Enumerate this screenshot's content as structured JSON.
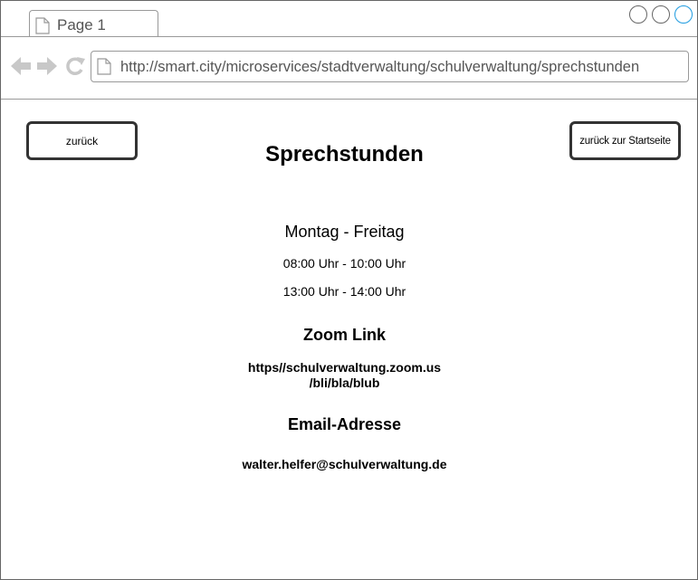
{
  "browser": {
    "tab_label": "Page 1",
    "url": "http://smart.city/microservices/stadtverwaltung/schulverwaltung/sprechstunden",
    "accent": "#1e9be0"
  },
  "nav": {
    "back_label": "zurück",
    "home_label": "zurück zur Startseite"
  },
  "main": {
    "title": "Sprechstunden",
    "days": "Montag - Freitag",
    "times": [
      "08:00 Uhr - 10:00 Uhr",
      "13:00 Uhr - 14:00 Uhr"
    ],
    "zoom_heading": "Zoom Link",
    "zoom_link_line1": "https//schulverwaltung.zoom.us",
    "zoom_link_line2": "/bli/bla/blub",
    "email_heading": "Email-Adresse",
    "email": "walter.helfer@schulverwaltung.de"
  }
}
